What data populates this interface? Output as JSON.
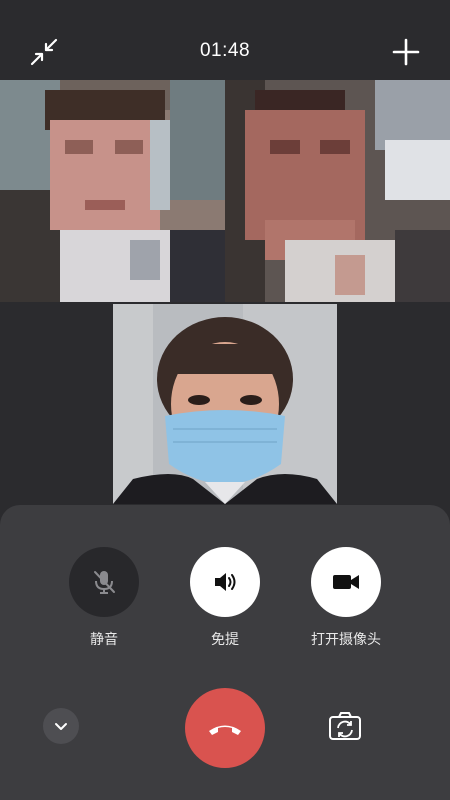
{
  "call": {
    "duration": "01:48"
  },
  "controls": {
    "mute_label": "静音",
    "speaker_label": "免提",
    "camera_label": "打开摄像头"
  },
  "icons": {
    "minimize": "minimize-arrows-icon",
    "add": "plus-icon",
    "mute": "microphone-off-icon",
    "speaker": "speaker-icon",
    "camera": "video-camera-icon",
    "collapse": "chevron-down-icon",
    "hangup": "phone-hangup-icon",
    "switch_camera": "camera-switch-icon"
  },
  "colors": {
    "background": "#2b2b2e",
    "panel": "#3d3d40",
    "hangup": "#d9534f",
    "button_light": "#ffffff",
    "button_dark": "#28282b"
  },
  "participants": [
    {
      "tile": "participant-video-1"
    },
    {
      "tile": "participant-video-2"
    },
    {
      "tile": "participant-video-3"
    }
  ]
}
